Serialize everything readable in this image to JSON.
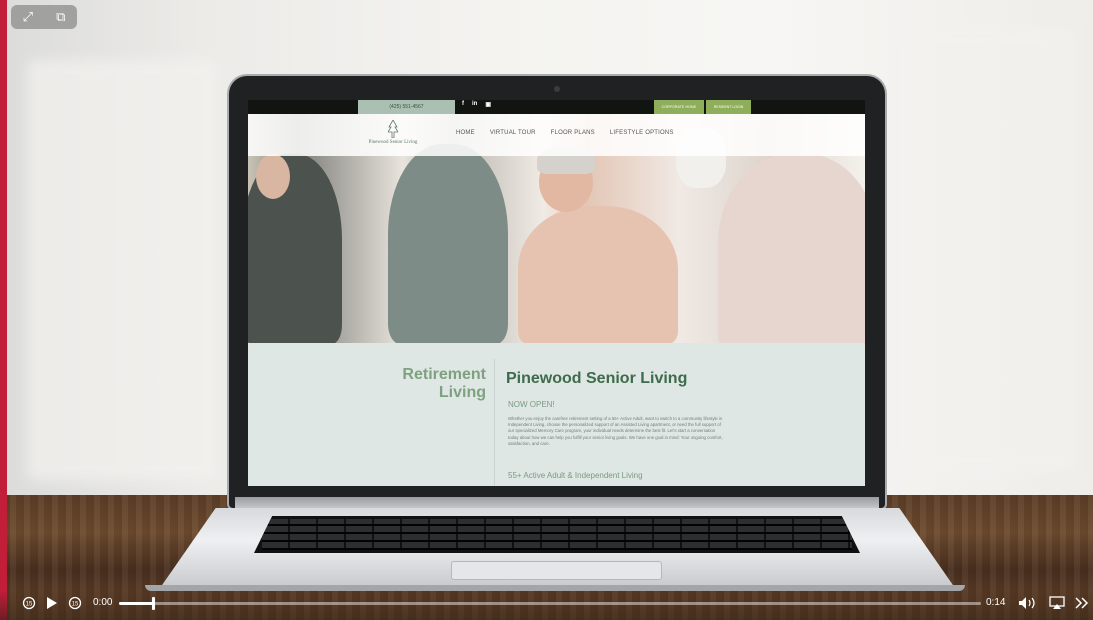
{
  "player": {
    "current_time": "0:00",
    "duration": "0:14",
    "progress": 0.04,
    "icons": [
      "expand-icon",
      "picture-in-picture-icon",
      "skip-back-icon",
      "play-icon",
      "skip-forward-icon",
      "volume-icon",
      "airplay-icon",
      "more-icon"
    ]
  },
  "site": {
    "phone": "(425) 551-4567",
    "social": [
      "f",
      "in",
      "▣"
    ],
    "corporate_btn": "CORPORATE HOME",
    "resident_btn": "RESIDENT LOGIN",
    "logo_text": "Pinewood Senior Living",
    "nav": [
      "HOME",
      "VIRTUAL TOUR",
      "FLOOR PLANS",
      "LIFESTYLE OPTIONS"
    ],
    "left_title_1": "Retirement",
    "left_title_2": "Living",
    "main_title": "Pinewood Senior Living",
    "now_open": "NOW OPEN!",
    "paragraph": "Whether you enjoy the carefree retirement setting of a 55+ Active Adult, want to switch to a community lifestyle in Independent Living, choose the personalized support of an Assisted Living apartment, or need the full support of our specialized Memory Care program, your individual needs determine the best fit. Let's start a conversation today about how we can help you fulfill your senior living goals. We have one goal in mind: Your ongoing comfort, satisfaction, and care.",
    "sub_heading": "55+ Active Adult & Independent Living"
  },
  "colors": {
    "accent_green": "#8fae5c",
    "heading_green": "#3f6a4b",
    "content_bg": "#dfe7e5",
    "frame_red": "#c21e3a"
  }
}
